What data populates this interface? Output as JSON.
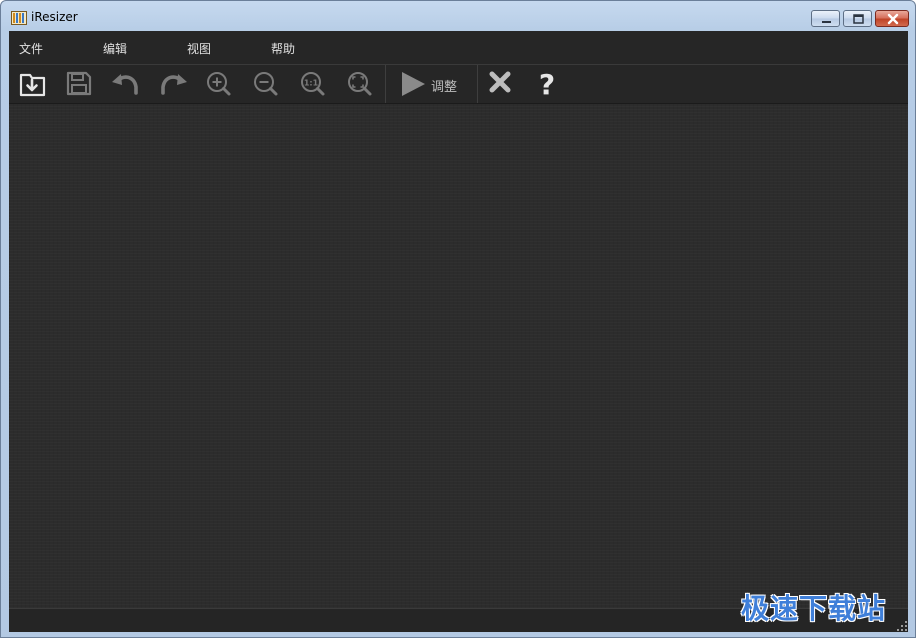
{
  "window": {
    "title": "iResizer"
  },
  "menu": {
    "items": [
      "文件",
      "编辑",
      "视图",
      "帮助"
    ]
  },
  "toolbar": {
    "buttons": [
      "open-icon",
      "save-icon",
      "undo-icon",
      "redo-icon",
      "zoom-in-icon",
      "zoom-out-icon",
      "zoom-actual-icon",
      "zoom-fit-icon",
      "play-icon",
      "close-x-icon",
      "help-icon"
    ],
    "run_label": "调整"
  },
  "watermark": {
    "text": "极速下载站"
  },
  "colors": {
    "canvas": "#2c2c2c",
    "toolbar": "#262626",
    "icon": "#bdbdbd",
    "watermark": "#3f7fd9"
  }
}
